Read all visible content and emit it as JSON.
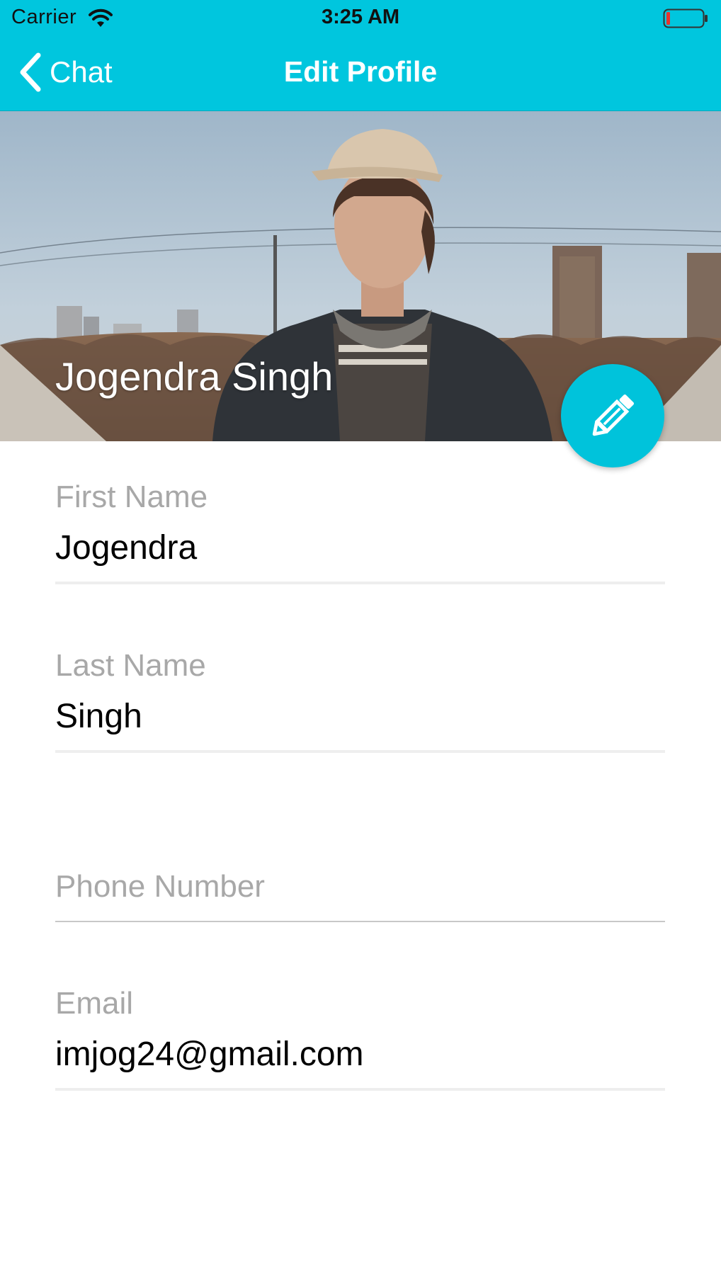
{
  "status_bar": {
    "carrier": "Carrier",
    "time": "3:25 AM"
  },
  "nav": {
    "back_label": "Chat",
    "title": "Edit Profile"
  },
  "profile": {
    "display_name": "Jogendra Singh"
  },
  "form": {
    "first_name": {
      "label": "First Name",
      "value": "Jogendra"
    },
    "last_name": {
      "label": "Last Name",
      "value": "Singh"
    },
    "phone": {
      "label": "Phone Number",
      "value": ""
    },
    "email": {
      "label": "Email",
      "value": "imjog24@gmail.com"
    }
  },
  "colors": {
    "accent": "#00c6de",
    "label": "#a8a8a8",
    "text": "#000000"
  },
  "icons": {
    "back": "chevron-left-icon",
    "edit": "pencil-icon",
    "wifi": "wifi-icon",
    "battery": "battery-low-icon"
  }
}
